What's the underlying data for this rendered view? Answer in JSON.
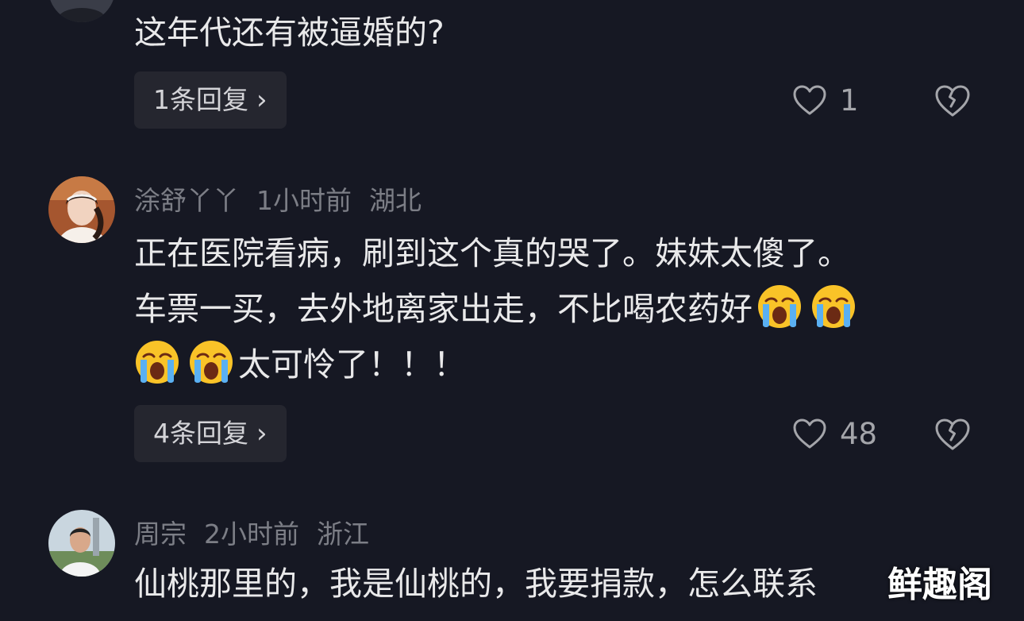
{
  "comments": [
    {
      "text": "这年代还有被逼婚的?",
      "reply_label": "1条回复",
      "likes": "1"
    },
    {
      "username": "涂舒丫丫",
      "time": "1小时前",
      "location": "湖北",
      "text_line1": "正在医院看病，刷到这个真的哭了。妹妹太傻了。",
      "text_line2": "车票一买，去外地离家出走，不比喝农药好",
      "text_line3": "太可怜了！！！",
      "reply_label": "4条回复",
      "likes": "48"
    },
    {
      "username": "周宗",
      "time": "2小时前",
      "location": "浙江",
      "text": "仙桃那里的，我是仙桃的，我要捐款，怎么联系"
    }
  ],
  "icons": {
    "reply_chevron": "chevron-right-icon",
    "like": "heart-icon",
    "dislike": "broken-heart-icon",
    "emoji": "loudly-crying-face-emoji"
  },
  "colors": {
    "background": "#161823",
    "primary_text": "#e9e9ea",
    "secondary_text": "#7c7e86",
    "reply_button": "#25262f"
  },
  "watermark": "鲜趣阁"
}
